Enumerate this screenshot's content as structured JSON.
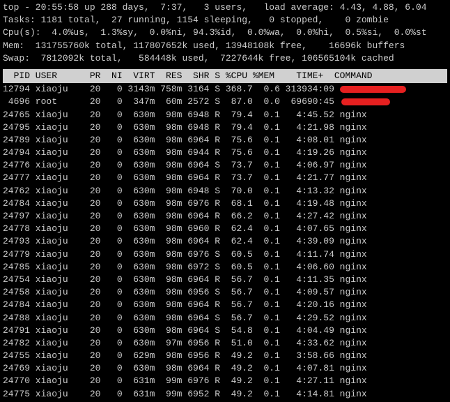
{
  "summary": {
    "line1": "top - 20:55:58 up 288 days,  7:37,   3 users,   load average: 4.43, 4.88, 6.04",
    "line2": "Tasks: 1181 total,  27 running, 1154 sleeping,   0 stopped,    0 zombie",
    "line3": "Cpu(s):  4.0%us,  1.3%sy,  0.0%ni, 94.3%id,  0.0%wa,  0.0%hi,  0.5%si,  0.0%st",
    "line4": "Mem:  131755760k total, 117807652k used, 13948108k free,    16696k buffers",
    "line5": "Swap:  7812092k total,   584448k used,  7227644k free, 106565104k cached"
  },
  "columns": "  PID USER      PR  NI  VIRT  RES  SHR S %CPU %MEM    TIME+  COMMAND           ",
  "rows": [
    {
      "pid": "12794",
      "user": "xiaoju",
      "pr": "20",
      "ni": "0",
      "virt": "3143m",
      "res": "758m",
      "shr": "3164",
      "s": "S",
      "cpu": "368.7",
      "mem": "0.6",
      "time": "313934:09",
      "cmd": "REDACT1"
    },
    {
      "pid": "4696",
      "user": "root",
      "pr": "20",
      "ni": "0",
      "virt": "347m",
      "res": "60m",
      "shr": "2572",
      "s": "S",
      "cpu": "87.0",
      "mem": "0.0",
      "time": "69690:45",
      "cmd": "REDACT2"
    },
    {
      "pid": "24765",
      "user": "xiaoju",
      "pr": "20",
      "ni": "0",
      "virt": "630m",
      "res": "98m",
      "shr": "6948",
      "s": "R",
      "cpu": "79.4",
      "mem": "0.1",
      "time": "4:45.52",
      "cmd": "nginx"
    },
    {
      "pid": "24795",
      "user": "xiaoju",
      "pr": "20",
      "ni": "0",
      "virt": "630m",
      "res": "98m",
      "shr": "6948",
      "s": "R",
      "cpu": "79.4",
      "mem": "0.1",
      "time": "4:21.98",
      "cmd": "nginx"
    },
    {
      "pid": "24789",
      "user": "xiaoju",
      "pr": "20",
      "ni": "0",
      "virt": "630m",
      "res": "98m",
      "shr": "6964",
      "s": "R",
      "cpu": "75.6",
      "mem": "0.1",
      "time": "4:08.01",
      "cmd": "nginx"
    },
    {
      "pid": "24794",
      "user": "xiaoju",
      "pr": "20",
      "ni": "0",
      "virt": "630m",
      "res": "98m",
      "shr": "6944",
      "s": "R",
      "cpu": "75.6",
      "mem": "0.1",
      "time": "4:19.26",
      "cmd": "nginx"
    },
    {
      "pid": "24776",
      "user": "xiaoju",
      "pr": "20",
      "ni": "0",
      "virt": "630m",
      "res": "98m",
      "shr": "6964",
      "s": "S",
      "cpu": "73.7",
      "mem": "0.1",
      "time": "4:06.97",
      "cmd": "nginx"
    },
    {
      "pid": "24777",
      "user": "xiaoju",
      "pr": "20",
      "ni": "0",
      "virt": "630m",
      "res": "98m",
      "shr": "6964",
      "s": "R",
      "cpu": "73.7",
      "mem": "0.1",
      "time": "4:21.77",
      "cmd": "nginx"
    },
    {
      "pid": "24762",
      "user": "xiaoju",
      "pr": "20",
      "ni": "0",
      "virt": "630m",
      "res": "98m",
      "shr": "6948",
      "s": "S",
      "cpu": "70.0",
      "mem": "0.1",
      "time": "4:13.32",
      "cmd": "nginx"
    },
    {
      "pid": "24784",
      "user": "xiaoju",
      "pr": "20",
      "ni": "0",
      "virt": "630m",
      "res": "98m",
      "shr": "6976",
      "s": "R",
      "cpu": "68.1",
      "mem": "0.1",
      "time": "4:19.48",
      "cmd": "nginx"
    },
    {
      "pid": "24797",
      "user": "xiaoju",
      "pr": "20",
      "ni": "0",
      "virt": "630m",
      "res": "98m",
      "shr": "6964",
      "s": "R",
      "cpu": "66.2",
      "mem": "0.1",
      "time": "4:27.42",
      "cmd": "nginx"
    },
    {
      "pid": "24778",
      "user": "xiaoju",
      "pr": "20",
      "ni": "0",
      "virt": "630m",
      "res": "98m",
      "shr": "6960",
      "s": "R",
      "cpu": "62.4",
      "mem": "0.1",
      "time": "4:07.65",
      "cmd": "nginx"
    },
    {
      "pid": "24793",
      "user": "xiaoju",
      "pr": "20",
      "ni": "0",
      "virt": "630m",
      "res": "98m",
      "shr": "6964",
      "s": "R",
      "cpu": "62.4",
      "mem": "0.1",
      "time": "4:39.09",
      "cmd": "nginx"
    },
    {
      "pid": "24779",
      "user": "xiaoju",
      "pr": "20",
      "ni": "0",
      "virt": "630m",
      "res": "98m",
      "shr": "6976",
      "s": "S",
      "cpu": "60.5",
      "mem": "0.1",
      "time": "4:11.74",
      "cmd": "nginx"
    },
    {
      "pid": "24785",
      "user": "xiaoju",
      "pr": "20",
      "ni": "0",
      "virt": "630m",
      "res": "98m",
      "shr": "6972",
      "s": "S",
      "cpu": "60.5",
      "mem": "0.1",
      "time": "4:06.60",
      "cmd": "nginx"
    },
    {
      "pid": "24754",
      "user": "xiaoju",
      "pr": "20",
      "ni": "0",
      "virt": "630m",
      "res": "98m",
      "shr": "6964",
      "s": "R",
      "cpu": "56.7",
      "mem": "0.1",
      "time": "4:11.35",
      "cmd": "nginx"
    },
    {
      "pid": "24758",
      "user": "xiaoju",
      "pr": "20",
      "ni": "0",
      "virt": "630m",
      "res": "98m",
      "shr": "6956",
      "s": "S",
      "cpu": "56.7",
      "mem": "0.1",
      "time": "4:09.57",
      "cmd": "nginx"
    },
    {
      "pid": "24784",
      "user": "xiaoju",
      "pr": "20",
      "ni": "0",
      "virt": "630m",
      "res": "98m",
      "shr": "6964",
      "s": "R",
      "cpu": "56.7",
      "mem": "0.1",
      "time": "4:20.16",
      "cmd": "nginx"
    },
    {
      "pid": "24788",
      "user": "xiaoju",
      "pr": "20",
      "ni": "0",
      "virt": "630m",
      "res": "98m",
      "shr": "6964",
      "s": "S",
      "cpu": "56.7",
      "mem": "0.1",
      "time": "4:29.52",
      "cmd": "nginx"
    },
    {
      "pid": "24791",
      "user": "xiaoju",
      "pr": "20",
      "ni": "0",
      "virt": "630m",
      "res": "98m",
      "shr": "6964",
      "s": "S",
      "cpu": "54.8",
      "mem": "0.1",
      "time": "4:04.49",
      "cmd": "nginx"
    },
    {
      "pid": "24782",
      "user": "xiaoju",
      "pr": "20",
      "ni": "0",
      "virt": "630m",
      "res": "97m",
      "shr": "6956",
      "s": "R",
      "cpu": "51.0",
      "mem": "0.1",
      "time": "4:33.62",
      "cmd": "nginx"
    },
    {
      "pid": "24755",
      "user": "xiaoju",
      "pr": "20",
      "ni": "0",
      "virt": "629m",
      "res": "98m",
      "shr": "6956",
      "s": "R",
      "cpu": "49.2",
      "mem": "0.1",
      "time": "3:58.66",
      "cmd": "nginx"
    },
    {
      "pid": "24769",
      "user": "xiaoju",
      "pr": "20",
      "ni": "0",
      "virt": "630m",
      "res": "98m",
      "shr": "6964",
      "s": "R",
      "cpu": "49.2",
      "mem": "0.1",
      "time": "4:07.81",
      "cmd": "nginx"
    },
    {
      "pid": "24770",
      "user": "xiaoju",
      "pr": "20",
      "ni": "0",
      "virt": "631m",
      "res": "99m",
      "shr": "6976",
      "s": "R",
      "cpu": "49.2",
      "mem": "0.1",
      "time": "4:27.11",
      "cmd": "nginx"
    },
    {
      "pid": "24775",
      "user": "xiaoju",
      "pr": "20",
      "ni": "0",
      "virt": "631m",
      "res": "99m",
      "shr": "6952",
      "s": "R",
      "cpu": "49.2",
      "mem": "0.1",
      "time": "4:14.81",
      "cmd": "nginx"
    }
  ]
}
